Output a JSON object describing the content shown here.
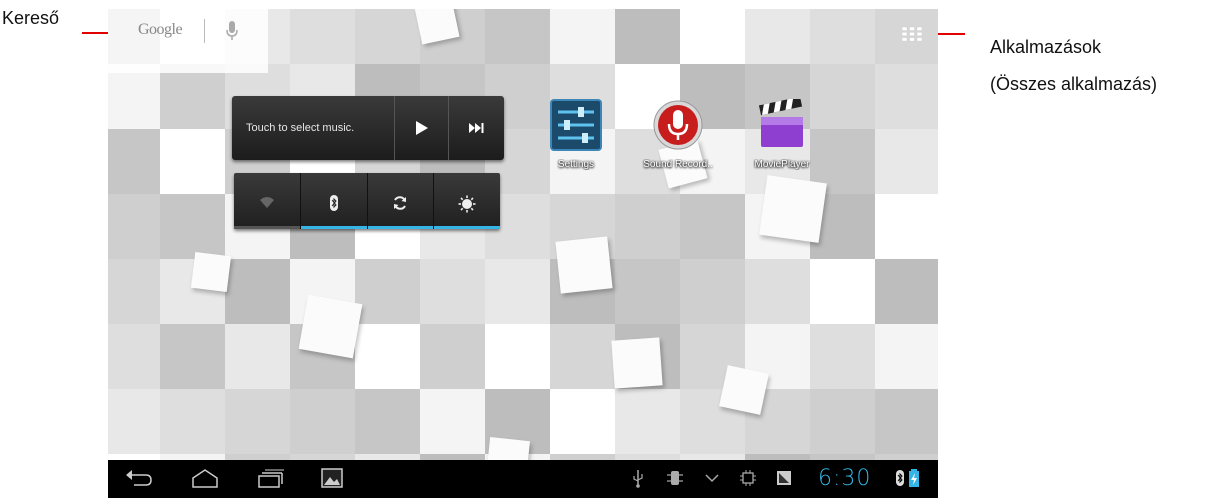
{
  "annotations": {
    "search_label": "Kereső",
    "apps_label": "Alkalmazások",
    "apps_sublabel": "(Összes alkalmazás)"
  },
  "search_bar": {
    "logo_text": "Google",
    "icons": [
      "microphone-icon"
    ]
  },
  "apps_button": {
    "icon": "grid-icon"
  },
  "music_widget": {
    "prompt": "Touch to select music.",
    "buttons": [
      "play-icon",
      "next-icon"
    ]
  },
  "power_control": {
    "buttons": [
      {
        "icon": "wifi-icon",
        "active": false
      },
      {
        "icon": "bluetooth-icon",
        "active": true
      },
      {
        "icon": "sync-icon",
        "active": true
      },
      {
        "icon": "brightness-icon",
        "active": true
      }
    ]
  },
  "apps": [
    {
      "label": "Settings",
      "icon": "settings-icon"
    },
    {
      "label": "Sound Record..",
      "icon": "microphone-icon"
    },
    {
      "label": "MoviePlayer",
      "icon": "clapperboard-icon"
    }
  ],
  "navbar": {
    "buttons": [
      "back-icon",
      "home-icon",
      "recent-apps-icon",
      "screenshot-icon"
    ],
    "status_icons": [
      "usb-icon",
      "debug-icon",
      "chevron-down-icon",
      "cpu-icon",
      "notification-icon"
    ],
    "clock": "6:30",
    "tray_icons": [
      "bluetooth-icon",
      "battery-charging-icon"
    ]
  },
  "colors": {
    "accent": "#33b5e5",
    "annotation_arrow": "#e00000",
    "navbar": "#000000"
  }
}
